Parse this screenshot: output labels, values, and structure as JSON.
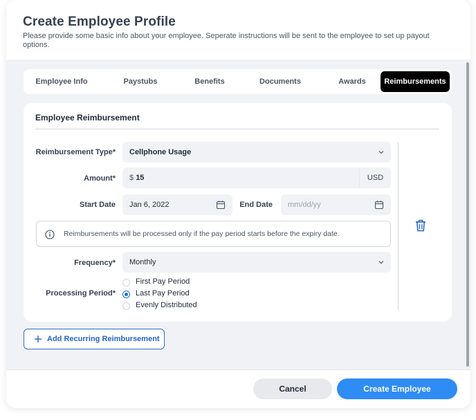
{
  "header": {
    "title": "Create Employee Profile",
    "subtitle": "Please provide some basic info about your employee. Seperate instructions will be sent to the employee to set up payout options."
  },
  "tabs": [
    {
      "label": "Employee Info",
      "active": false
    },
    {
      "label": "Paystubs",
      "active": false
    },
    {
      "label": "Benefits",
      "active": false
    },
    {
      "label": "Documents",
      "active": false
    },
    {
      "label": "Awards",
      "active": false
    },
    {
      "label": "Reimbursements",
      "active": true
    }
  ],
  "card": {
    "title": "Employee Reimbursement",
    "reimbursement_type": {
      "label": "Reimbursement Type*",
      "value": "Cellphone Usage"
    },
    "amount": {
      "label": "Amount*",
      "prefix": "$",
      "value": "15",
      "currency": "USD"
    },
    "start_date": {
      "label": "Start Date",
      "value": "Jan 6, 2022"
    },
    "end_date": {
      "label": "End Date",
      "placeholder": "mm/dd/yy"
    },
    "info_text": "Reimbursements will be processed only if the pay period starts before the expiry date.",
    "frequency": {
      "label": "Frequency*",
      "value": "Monthly"
    },
    "processing_period": {
      "label": "Processing Period*",
      "options": [
        {
          "label": "First Pay Period",
          "selected": false
        },
        {
          "label": "Last Pay Period",
          "selected": true
        },
        {
          "label": "Evenly Distributed",
          "selected": false
        }
      ]
    }
  },
  "add_button": {
    "label": "Add Recurring Reimbursement"
  },
  "footer": {
    "cancel_label": "Cancel",
    "create_label": "Create Employee"
  },
  "colors": {
    "accent": "#2f8cf5",
    "active_tab": "#000000",
    "background": "#f1f2f6"
  }
}
